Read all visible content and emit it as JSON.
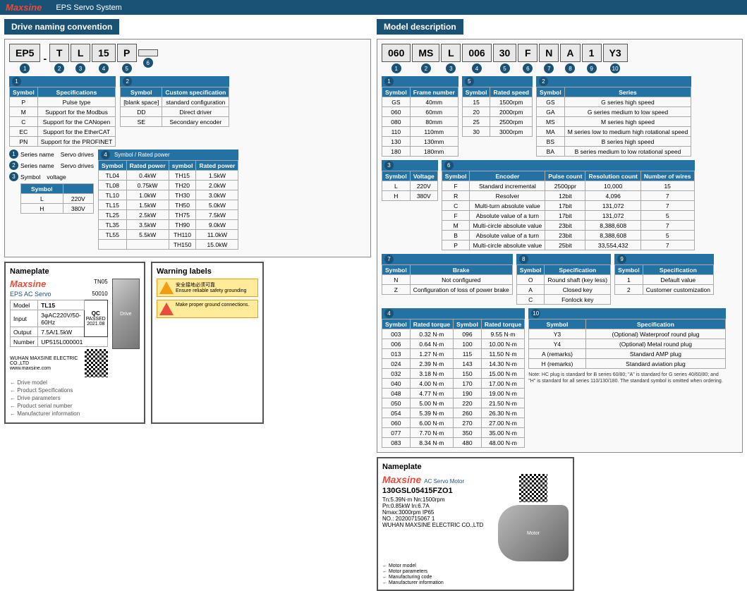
{
  "topbar": {
    "brand": "Maxsine",
    "system": "EPS Servo System"
  },
  "drive_naming": {
    "title": "Drive naming convention",
    "codes": [
      "EP5",
      "-",
      "T",
      "L",
      "15",
      "P"
    ],
    "numbers": [
      "1",
      "2",
      "3",
      "4",
      "5",
      "6"
    ],
    "rows": [
      {
        "num": "1",
        "label1": "Series name",
        "val1": "Servo drives",
        "label2": null,
        "val2": null
      },
      {
        "num": "2",
        "label1": "Series name",
        "val1": "Servo drives",
        "label2": null,
        "val2": null
      },
      {
        "num": "3",
        "label1": "Symbol",
        "val1": "voltage",
        "label2": null,
        "val2": null
      }
    ],
    "voltage_table": {
      "headers": [
        "Symbol",
        ""
      ],
      "rows": [
        [
          "L",
          "220V"
        ],
        [
          "H",
          "380V"
        ]
      ]
    },
    "table1": {
      "num": "1",
      "label": "Symbol",
      "headers": [
        "Symbol",
        "Specifications"
      ],
      "rows": [
        [
          "P",
          "Pulse type"
        ],
        [
          "M",
          "Support for the Modbus"
        ],
        [
          "C",
          "Support for the CANopen"
        ],
        [
          "EC",
          "Support for the EtherCAT"
        ],
        [
          "PN",
          "Support for the PROFINET"
        ]
      ]
    },
    "table2": {
      "num": "2",
      "headers": [
        "Symbol",
        "Custom specification"
      ],
      "rows": [
        [
          "[blank space]",
          "standard configuration"
        ],
        [
          "DD",
          "Direct driver"
        ],
        [
          "SE",
          "Secondary encoder"
        ]
      ]
    },
    "power_table": {
      "num": "4",
      "headers": [
        "Symbol",
        "Rated power",
        "symbol",
        "Rated power"
      ],
      "rows": [
        [
          "TL04",
          "0.4kW",
          "TH15",
          "1.5kW"
        ],
        [
          "TL08",
          "0.75kW",
          "TH20",
          "2.0kW"
        ],
        [
          "TL10",
          "1.0kW",
          "TH30",
          "3.0kW"
        ],
        [
          "TL15",
          "1.5kW",
          "TH50",
          "5.0kW"
        ],
        [
          "TL25",
          "2.5kW",
          "TH75",
          "7.5kW"
        ],
        [
          "TL35",
          "3.5kW",
          "TH90",
          "9.0kW"
        ],
        [
          "TL55",
          "5.5kW",
          "TH110",
          "11.0kW"
        ],
        [
          "",
          "",
          "TH150",
          "15.0kW"
        ]
      ]
    }
  },
  "model_desc": {
    "title": "Model description",
    "codes": [
      "060",
      "MS",
      "L",
      "006",
      "30",
      "F",
      "N",
      "A",
      "1",
      "Y3"
    ],
    "numbers": [
      "1",
      "2",
      "3",
      "4",
      "5",
      "6",
      "7",
      "8",
      "9",
      "10"
    ],
    "frame_table": {
      "headers": [
        "Symbol",
        "Frame number"
      ],
      "rows": [
        [
          "GS",
          "40mm"
        ],
        [
          "060",
          "60mm"
        ],
        [
          "080",
          "80mm"
        ],
        [
          "110",
          "110mm"
        ],
        [
          "130",
          "130mm"
        ],
        [
          "180",
          "180mm"
        ]
      ]
    },
    "speed_table": {
      "headers": [
        "Symbol",
        "Rated speed"
      ],
      "rows": [
        [
          "15",
          "1500rpm"
        ],
        [
          "20",
          "2000rpm"
        ],
        [
          "25",
          "2500rpm"
        ],
        [
          "30",
          "3000rpm"
        ]
      ]
    },
    "series_table": {
      "headers": [
        "Symbol",
        "Series"
      ],
      "rows": [
        [
          "GS",
          "G series high speed"
        ],
        [
          "GA",
          "G series medium to low speed"
        ],
        [
          "MS",
          "M series high speed"
        ],
        [
          "MA",
          "M series low to medium high rotational speed"
        ],
        [
          "BS",
          "B series high speed"
        ],
        [
          "BA",
          "B series medium to low rotational speed"
        ]
      ]
    },
    "voltage_table": {
      "headers": [
        "Symbol",
        "Voltage"
      ],
      "rows": [
        [
          "L",
          "220V"
        ],
        [
          "H",
          "380V"
        ]
      ]
    },
    "encoder_table": {
      "headers": [
        "Symbol",
        "Encoder",
        "Pulse count",
        "Resolution count",
        "Number of wires"
      ],
      "rows": [
        [
          "F",
          "Standard incremental",
          "2500ppr",
          "10,000",
          "15"
        ],
        [
          "R",
          "Resolver",
          "12bit",
          "4,096",
          "7"
        ],
        [
          "C",
          "Multi-turn absolute value",
          "17bit",
          "131,072",
          "7"
        ],
        [
          "F",
          "Absolute value of a turn",
          "17bit",
          "131,072",
          "5"
        ],
        [
          "M",
          "Multi-circle absolute value",
          "23bit",
          "8,388,608",
          "7"
        ],
        [
          "B",
          "Absolute value of a turn",
          "23bit",
          "8,388,608",
          "5"
        ],
        [
          "P",
          "Multi-circle absolute value",
          "25bit",
          "33,554,432",
          "7"
        ]
      ]
    },
    "brake_table": {
      "headers": [
        "Symbol",
        "Brake"
      ],
      "rows": [
        [
          "N",
          "Not configured"
        ],
        [
          "Z",
          "Configuration of loss of power brake"
        ]
      ]
    },
    "shaft_table": {
      "headers": [
        "Symbol",
        "Specification"
      ],
      "rows": [
        [
          "O",
          "Round shaft (key less)"
        ],
        [
          "A",
          "Closed key"
        ],
        [
          "C",
          "Fonlock key"
        ]
      ]
    },
    "custom_table": {
      "headers": [
        "Symbol",
        "Specification"
      ],
      "rows": [
        [
          "1",
          "Default value"
        ],
        [
          "2",
          "Customer customization"
        ]
      ]
    },
    "torque_table": {
      "headers": [
        "Symbol",
        "Rated torque",
        "Symbol",
        "Rated torque"
      ],
      "rows": [
        [
          "003",
          "0.32 N·m",
          "096",
          "9.55 N·m"
        ],
        [
          "006",
          "0.64 N·m",
          "100",
          "10.00 N·m"
        ],
        [
          "013",
          "1.27 N·m",
          "115",
          "11.50 N·m"
        ],
        [
          "024",
          "2.39 N·m",
          "143",
          "14.30 N·m"
        ],
        [
          "032",
          "3.18 N·m",
          "150",
          "15.00 N·m"
        ],
        [
          "040",
          "4.00 N·m",
          "170",
          "17.00 N·m"
        ],
        [
          "048",
          "4.77 N·m",
          "190",
          "19.00 N·m"
        ],
        [
          "050",
          "5.00 N·m",
          "220",
          "21.50 N·m"
        ],
        [
          "054",
          "5.39 N·m",
          "260",
          "26.30 N·m"
        ],
        [
          "060",
          "6.00 N·m",
          "270",
          "27.00 N·m"
        ],
        [
          "077",
          "7.70 N·m",
          "350",
          "35.00 N·m"
        ],
        [
          "083",
          "8.34 N·m",
          "480",
          "48.00 N·m"
        ]
      ]
    },
    "plug_table": {
      "headers": [
        "Symbol",
        "Specification"
      ],
      "rows": [
        [
          "Y3",
          "(Optional) Waterproof round plug"
        ],
        [
          "Y4",
          "(Optional) Metal round plug"
        ],
        [
          "A (remarks)",
          "Standard AMP plug"
        ],
        [
          "H (remarks)",
          "Standard aviation plug"
        ]
      ],
      "note": "Note: HC plug is standard for B series 60/80; 'A' is standard for G series 40/60/80; and 'H' is standard for all series 110/130/180. The standard symbol is omitted when ordering."
    }
  },
  "nameplate_drive": {
    "title": "Nameplate",
    "brand": "Maxsine",
    "sub": "EPS AC Servo",
    "model_label": "Drive model",
    "model_value": "TL15",
    "product_specs_label": "Product Specifications",
    "drive_params_label": "Drive parameters",
    "input_label": "Input",
    "input_value": "3φAC220V/50-60Hz",
    "output_label": "Output",
    "output_value": "7.5A/1.5kW",
    "serial_label": "Product serial number",
    "serial_value": "UP515L000001",
    "mfr_label": "Manufacturer information",
    "mfr_value": "WUHAN MAXSINE ELECTRIC CO.,LTD",
    "website": "www.maxsine.com",
    "model_plate": "TN05",
    "model_num": "50010",
    "qc_text": "QC PASSED 2021.08"
  },
  "nameplate_motor": {
    "title": "Nameplate",
    "brand": "Maxsine",
    "sub": "AC Servo Motor",
    "model_label": "Motor model",
    "model_value": "130GSL05415FZO1",
    "params_label": "Motor parameters",
    "params_value": "Tn:5.39N·m  Nn:1500rpm",
    "params2": "Pn:0.85kW  In:6.7A",
    "params3": "Nmax:3000rpm  IP65",
    "mfg_label": "Manufacturing code",
    "mfg_value": "NO.: 20200715067 1",
    "mfr_label": "Manufacturer information",
    "mfr_value": "WUHAN MAXSINE ELECTRIC CO.,LTD"
  },
  "warning": {
    "title": "Warning labels",
    "text1": "安全接地必须可靠...",
    "text2": "Make proper ground connections."
  }
}
